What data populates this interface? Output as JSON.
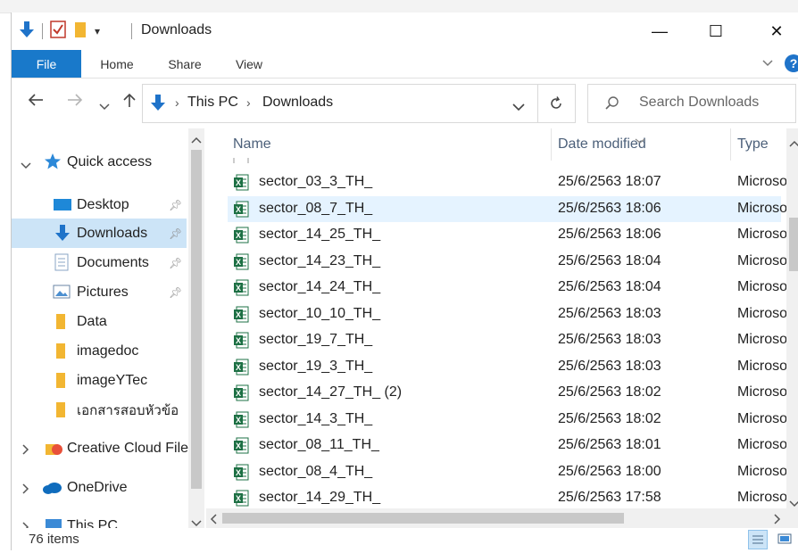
{
  "window": {
    "title": "Downloads",
    "controls": {
      "minimize": "—",
      "maximize": "☐",
      "close": "✕"
    }
  },
  "ribbon": {
    "tabs": [
      "File",
      "Home",
      "Share",
      "View"
    ],
    "help": "?"
  },
  "address": {
    "crumbs": [
      "This PC",
      "Downloads"
    ],
    "search_placeholder": "Search Downloads"
  },
  "nav": {
    "quick_access": "Quick access",
    "items": [
      {
        "label": "Desktop",
        "icon": "desktop-icon",
        "pinned": true
      },
      {
        "label": "Downloads",
        "icon": "download-folder-icon",
        "pinned": true,
        "selected": true
      },
      {
        "label": "Documents",
        "icon": "documents-icon",
        "pinned": true
      },
      {
        "label": "Pictures",
        "icon": "pictures-icon",
        "pinned": true
      },
      {
        "label": "Data",
        "icon": "folder-icon"
      },
      {
        "label": "imagedoc",
        "icon": "folder-icon"
      },
      {
        "label": "imageYTec",
        "icon": "folder-icon"
      },
      {
        "label": "เอกสารสอบหัวข้อ",
        "icon": "folder-icon"
      }
    ],
    "roots": [
      {
        "label": "Creative Cloud Files",
        "icon": "creative-cloud-icon"
      },
      {
        "label": "OneDrive",
        "icon": "onedrive-icon"
      },
      {
        "label": "This PC",
        "icon": "this-pc-icon"
      }
    ]
  },
  "columns": {
    "name": "Name",
    "date": "Date modified",
    "type": "Type"
  },
  "files": [
    {
      "name": "sector_03_3_TH_",
      "date": "25/6/2563 18:07",
      "type": "Microsoft Excel"
    },
    {
      "name": "sector_08_7_TH_",
      "date": "25/6/2563 18:06",
      "type": "Microsoft Excel",
      "highlighted": true
    },
    {
      "name": "sector_14_25_TH_",
      "date": "25/6/2563 18:06",
      "type": "Microsoft Excel"
    },
    {
      "name": "sector_14_23_TH_",
      "date": "25/6/2563 18:04",
      "type": "Microsoft Excel"
    },
    {
      "name": "sector_14_24_TH_",
      "date": "25/6/2563 18:04",
      "type": "Microsoft Excel"
    },
    {
      "name": "sector_10_10_TH_",
      "date": "25/6/2563 18:03",
      "type": "Microsoft Excel"
    },
    {
      "name": "sector_19_7_TH_",
      "date": "25/6/2563 18:03",
      "type": "Microsoft Excel"
    },
    {
      "name": "sector_19_3_TH_",
      "date": "25/6/2563 18:03",
      "type": "Microsoft Excel"
    },
    {
      "name": "sector_14_27_TH_ (2)",
      "date": "25/6/2563 18:02",
      "type": "Microsoft Excel"
    },
    {
      "name": "sector_14_3_TH_",
      "date": "25/6/2563 18:02",
      "type": "Microsoft Excel"
    },
    {
      "name": "sector_08_11_TH_",
      "date": "25/6/2563 18:01",
      "type": "Microsoft Excel"
    },
    {
      "name": "sector_08_4_TH_",
      "date": "25/6/2563 18:00",
      "type": "Microsoft Excel"
    },
    {
      "name": "sector_14_29_TH_",
      "date": "25/6/2563 17:58",
      "type": "Microsoft Excel"
    }
  ],
  "status": {
    "item_count": "76 items"
  },
  "colors": {
    "accent": "#1979ca",
    "selection": "#cce4f7",
    "hover_row": "#e5f3ff",
    "excel_green": "#1d7044"
  }
}
